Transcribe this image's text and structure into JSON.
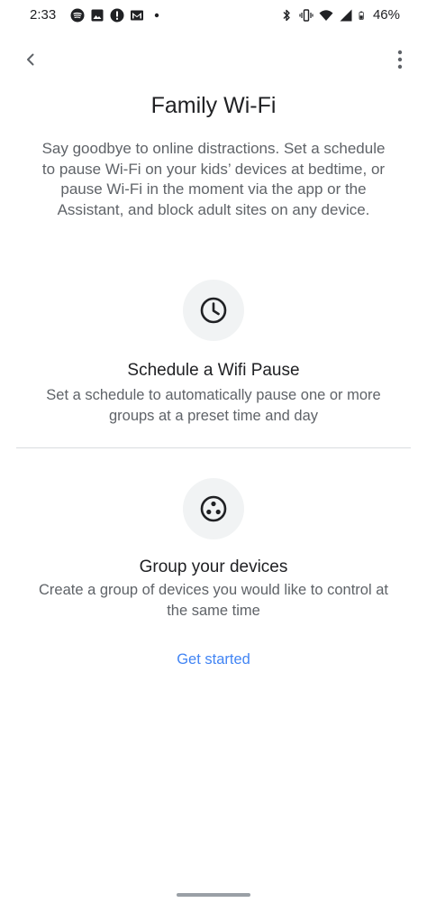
{
  "status_bar": {
    "time": "2:33",
    "left_icons": [
      "spotify-icon",
      "image-icon",
      "alert-icon",
      "gmail-icon",
      "dot-icon"
    ],
    "right_icons": [
      "bluetooth-icon",
      "vibrate-icon",
      "wifi-icon",
      "cellular-icon",
      "battery-icon"
    ],
    "battery": "46%"
  },
  "app_bar": {
    "back_icon": "chevron-left-icon",
    "menu_icon": "more-vert-icon"
  },
  "page": {
    "title": "Family Wi-Fi",
    "intro": "Say goodbye to online distractions. Set a schedule to pause Wi-Fi on your kids’ devices at bedtime, or pause Wi-Fi in the moment via the app or the Assistant, and block adult sites on any device."
  },
  "features": [
    {
      "icon": "clock-icon",
      "title": "Schedule a Wifi Pause",
      "description": "Set a schedule to automatically pause one or more groups at a preset time and day"
    },
    {
      "icon": "device-group-icon",
      "title": "Group your devices",
      "description": "Create a group of devices you would like to control at the same time"
    }
  ],
  "cta": {
    "label": "Get started"
  },
  "colors": {
    "accent": "#4285f4",
    "text_primary": "#202124",
    "text_secondary": "#5f6368",
    "icon_bg": "#f1f3f4",
    "divider": "#dadce0"
  }
}
